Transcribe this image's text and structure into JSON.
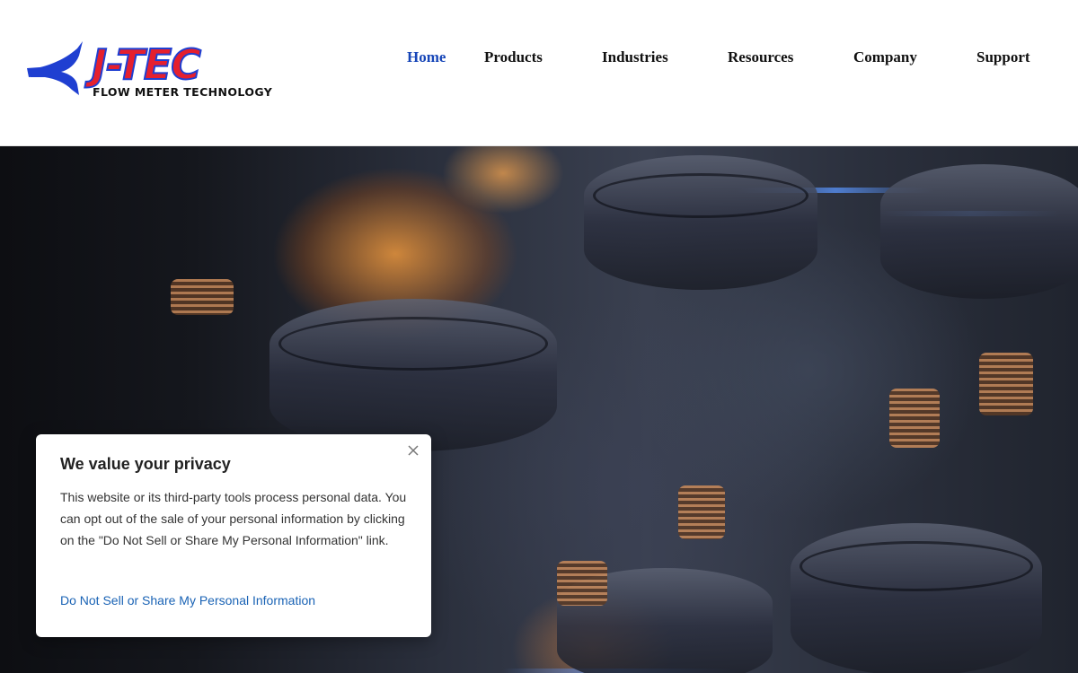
{
  "header": {
    "logo_text": "J-TEC",
    "logo_tagline": "FLOW METER TECHNOLOGY"
  },
  "nav": {
    "items": [
      {
        "label": "Home",
        "active": true
      },
      {
        "label": "Products",
        "active": false
      },
      {
        "label": "Industries",
        "active": false
      },
      {
        "label": "Resources",
        "active": false
      },
      {
        "label": "Company",
        "active": false
      },
      {
        "label": "Support",
        "active": false
      }
    ]
  },
  "hero": {
    "image": "engine-pistons-image"
  },
  "privacy_banner": {
    "title": "We value your privacy",
    "body": "This website or its third-party tools process personal data. You can opt out of the sale of your personal information by clicking on the \"Do Not Sell or Share My Personal Information\" link.",
    "link_label": "Do Not Sell or Share My Personal Information",
    "close_icon": "close-icon"
  },
  "colors": {
    "brand_red": "#e5202e",
    "brand_blue": "#1f3fd1",
    "nav_active": "#1746b8",
    "link": "#1a63b5"
  }
}
